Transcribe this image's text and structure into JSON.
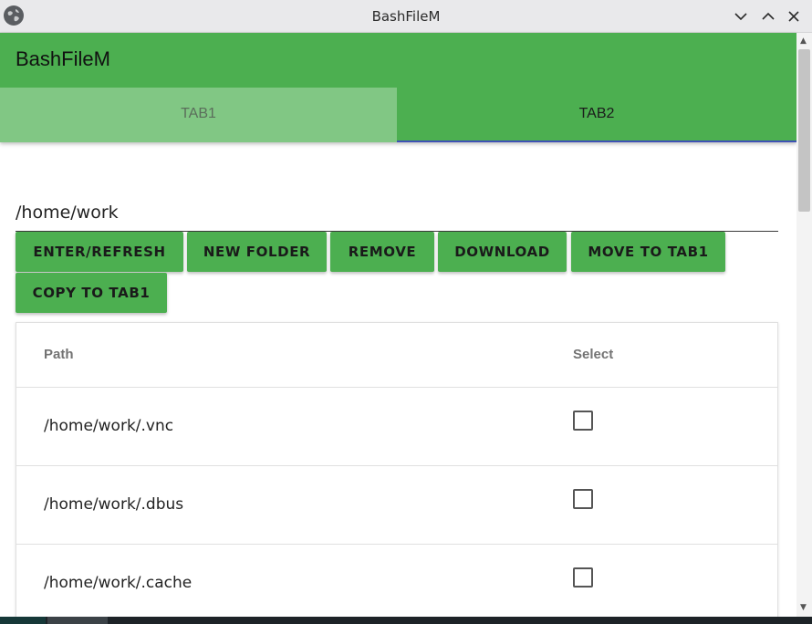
{
  "window": {
    "title": "BashFileM",
    "icon": "globe-icon",
    "controls": [
      "minimize-chevron-down-icon",
      "maximize-chevron-up-icon",
      "close-icon"
    ]
  },
  "appbar": {
    "title": "BashFileM",
    "color": "#4caf50"
  },
  "tabs": [
    {
      "label": "TAB1",
      "active": false
    },
    {
      "label": "TAB2",
      "active": true
    }
  ],
  "path_input": {
    "value": "/home/work"
  },
  "buttons": {
    "enter_refresh": "ENTER/REFRESH",
    "new_folder": "NEW FOLDER",
    "remove": "REMOVE",
    "download": "DOWNLOAD",
    "move_to_tab1": "MOVE TO TAB1",
    "copy_to_tab1": "COPY TO TAB1"
  },
  "table": {
    "headers": {
      "path": "Path",
      "select": "Select"
    },
    "rows": [
      {
        "path": "/home/work/.vnc",
        "selected": false
      },
      {
        "path": "/home/work/.dbus",
        "selected": false
      },
      {
        "path": "/home/work/.cache",
        "selected": false
      }
    ]
  },
  "colors": {
    "accent": "#4caf50",
    "tab_inactive": "#81c784",
    "tab_indicator": "#3f51b5"
  }
}
